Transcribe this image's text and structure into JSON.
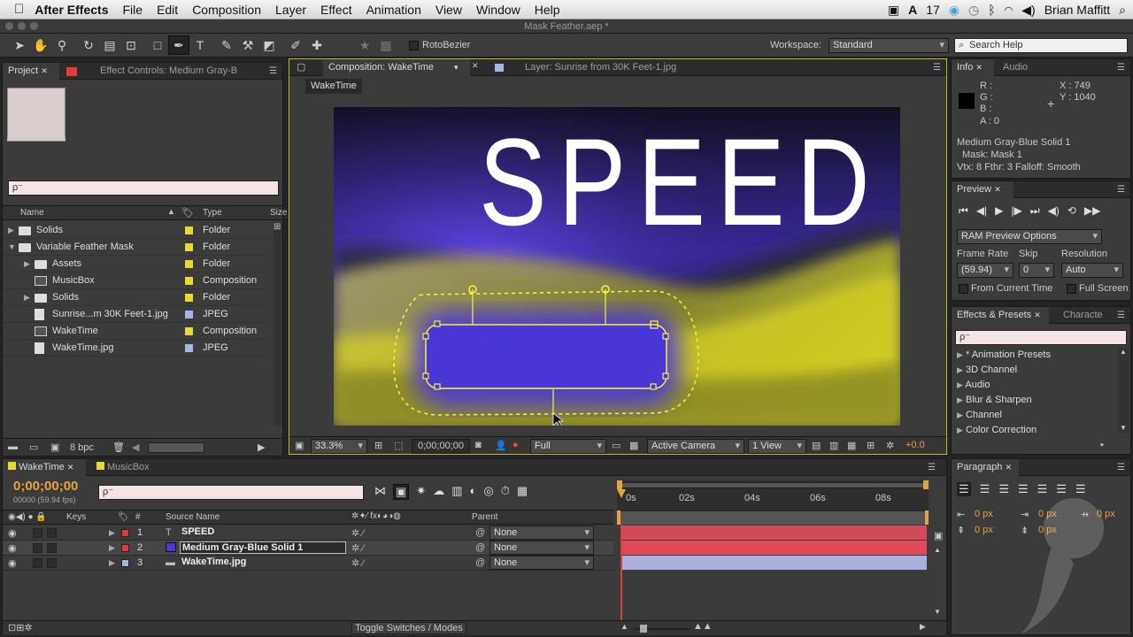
{
  "menubar": {
    "apple": "",
    "app": "After Effects",
    "items": [
      "File",
      "Edit",
      "Composition",
      "Layer",
      "Effect",
      "Animation",
      "View",
      "Window",
      "Help"
    ],
    "adobe_badge": "17",
    "user": "Brian Maffitt"
  },
  "titlebar": {
    "title": "Mask Feather.aep *"
  },
  "toolbar": {
    "rotobezier": "RotoBezier",
    "workspace_label": "Workspace:",
    "workspace_value": "Standard",
    "search_placeholder": "Search Help"
  },
  "project": {
    "tab_project": "Project",
    "tab_effects": "Effect Controls: Medium Gray-B",
    "search": "ρ⁻",
    "col_name": "Name",
    "col_type": "Type",
    "col_size": "Size",
    "items": [
      {
        "name": "Solids",
        "type": "Folder",
        "indent": 0,
        "icon": "folder",
        "color": "#e8d832"
      },
      {
        "name": "Variable Feather Mask",
        "type": "Folder",
        "indent": 0,
        "icon": "folder",
        "color": "#e8d832",
        "open": true
      },
      {
        "name": "Assets",
        "type": "Folder",
        "indent": 1,
        "icon": "folder",
        "color": "#e8d832"
      },
      {
        "name": "MusicBox",
        "type": "Composition",
        "indent": 1,
        "icon": "comp",
        "color": "#e8d832"
      },
      {
        "name": "Solids",
        "type": "Folder",
        "indent": 1,
        "icon": "folder",
        "color": "#e8d832"
      },
      {
        "name": "Sunrise...m 30K Feet-1.jpg",
        "type": "JPEG",
        "indent": 1,
        "icon": "file",
        "color": "#a9b4e6"
      },
      {
        "name": "WakeTime",
        "type": "Composition",
        "indent": 1,
        "icon": "comp",
        "color": "#e8d832"
      },
      {
        "name": "WakeTime.jpg",
        "type": "JPEG",
        "indent": 1,
        "icon": "file",
        "color": "#a9b4e6"
      }
    ],
    "bpc": "8 bpc"
  },
  "composition": {
    "tab_comp": "Composition: WakeTime",
    "tab_layer": "Layer: Sunrise from 30K Feet-1.jpg",
    "breadcrumb": "WakeTime",
    "title_text": "SPEED",
    "zoom": "33.3%",
    "timecode": "0;00;00;00",
    "resolution": "Full",
    "camera": "Active Camera",
    "views": "1 View",
    "exposure": "+0.0"
  },
  "info": {
    "tab_info": "Info",
    "tab_audio": "Audio",
    "r": "R :",
    "g": "G :",
    "b": "B :",
    "a": "A : 0",
    "x": "X : 749",
    "y": "Y : 1040",
    "line1": "Medium Gray-Blue Solid 1",
    "line2": "Mask: Mask 1",
    "line3": "Vtx: 8 Fthr: 3 Falloff: Smooth"
  },
  "preview": {
    "tab": "Preview",
    "ram_options": "RAM Preview Options",
    "frame_rate_label": "Frame Rate",
    "skip_label": "Skip",
    "resolution_label": "Resolution",
    "frame_rate": "(59.94)",
    "skip": "0",
    "resolution": "Auto",
    "from_current": "From Current Time",
    "full_screen": "Full Screen"
  },
  "effects": {
    "tab": "Effects & Presets",
    "tab2": "Characte",
    "search": "ρ⁻",
    "items": [
      "* Animation Presets",
      "3D Channel",
      "Audio",
      "Blur & Sharpen",
      "Channel",
      "Color Correction"
    ]
  },
  "timeline": {
    "tab1": "WakeTime",
    "tab2": "MusicBox",
    "timecode": "0;00;00;00",
    "fps": "00000 (59.94 fps)",
    "search": "ρ⁻",
    "col_keys": "Keys",
    "col_num": "#",
    "col_source": "Source Name",
    "col_parent": "Parent",
    "ruler": [
      "0s",
      "02s",
      "04s",
      "06s",
      "08s"
    ],
    "layers": [
      {
        "num": "1",
        "name": "SPEED",
        "color": "#e03c3c",
        "icon": "T",
        "parent": "None",
        "bar": "#d24a5a"
      },
      {
        "num": "2",
        "name": "Medium Gray-Blue Solid 1",
        "color": "#e03c3c",
        "icon": "solid",
        "parent": "None",
        "bar": "#e04858",
        "selected": true
      },
      {
        "num": "3",
        "name": "WakeTime.jpg",
        "color": "#a9b4e6",
        "icon": "img",
        "parent": "None",
        "bar": "#a9b0e0"
      }
    ],
    "toggle": "Toggle Switches / Modes"
  },
  "paragraph": {
    "tab": "Paragraph",
    "v1": "0 px",
    "v2": "0 px",
    "v3": "0 px",
    "v4": "0 px",
    "v5": "0 px"
  },
  "colors": {
    "accent": "#e6a23c",
    "mask": "#ffff66",
    "solid": "#4b37d6"
  }
}
